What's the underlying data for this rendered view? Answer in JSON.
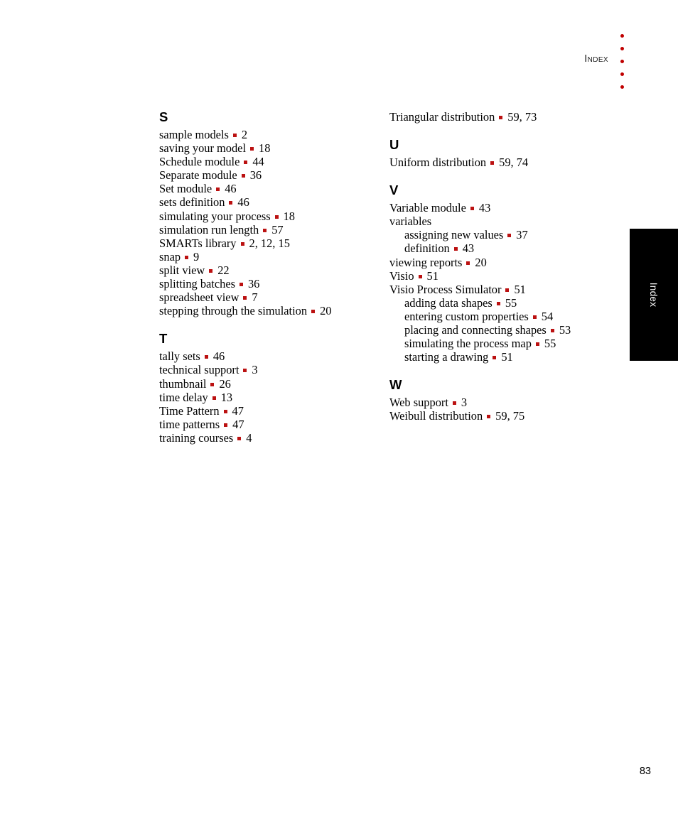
{
  "header": {
    "label": "Index",
    "dot_count": 5,
    "dot_color": "#c00000"
  },
  "side_tab": {
    "label": "Index",
    "background": "#000000",
    "text_color": "#ffffff"
  },
  "bullet_color": "#bb1111",
  "folio": {
    "page_number": "83"
  },
  "columns": [
    {
      "name": "left",
      "sections": [
        {
          "letter": "S",
          "entries": [
            {
              "text": "sample models",
              "pages": "2",
              "level": 0
            },
            {
              "text": "saving your model",
              "pages": "18",
              "level": 0
            },
            {
              "text": "Schedule module",
              "pages": "44",
              "level": 0
            },
            {
              "text": "Separate module",
              "pages": "36",
              "level": 0
            },
            {
              "text": "Set module",
              "pages": "46",
              "level": 0
            },
            {
              "text": "sets definition",
              "pages": "46",
              "level": 0
            },
            {
              "text": "simulating your process",
              "pages": "18",
              "level": 0
            },
            {
              "text": "simulation run length",
              "pages": "57",
              "level": 0
            },
            {
              "text": "SMARTs library",
              "pages": "2, 12, 15",
              "level": 0
            },
            {
              "text": "snap",
              "pages": "9",
              "level": 0
            },
            {
              "text": "split view",
              "pages": "22",
              "level": 0
            },
            {
              "text": "splitting batches",
              "pages": "36",
              "level": 0
            },
            {
              "text": "spreadsheet view",
              "pages": "7",
              "level": 0
            },
            {
              "text": "stepping through the simulation",
              "pages": "20",
              "level": 0
            }
          ]
        },
        {
          "letter": "T",
          "entries": [
            {
              "text": "tally sets",
              "pages": "46",
              "level": 0
            },
            {
              "text": "technical support",
              "pages": "3",
              "level": 0
            },
            {
              "text": "thumbnail",
              "pages": "26",
              "level": 0
            },
            {
              "text": "time delay",
              "pages": "13",
              "level": 0
            },
            {
              "text": "Time Pattern",
              "pages": "47",
              "level": 0
            },
            {
              "text": "time patterns",
              "pages": "47",
              "level": 0
            },
            {
              "text": "training courses",
              "pages": "4",
              "level": 0
            }
          ]
        }
      ]
    },
    {
      "name": "right",
      "sections": [
        {
          "letter": "",
          "entries": [
            {
              "text": "Triangular distribution",
              "pages": "59, 73",
              "level": 0
            }
          ]
        },
        {
          "letter": "U",
          "entries": [
            {
              "text": "Uniform distribution",
              "pages": "59, 74",
              "level": 0
            }
          ]
        },
        {
          "letter": "V",
          "entries": [
            {
              "text": "Variable module",
              "pages": "43",
              "level": 0
            },
            {
              "text": "variables",
              "pages": "",
              "level": 0
            },
            {
              "text": "assigning new values",
              "pages": "37",
              "level": 1
            },
            {
              "text": "definition",
              "pages": "43",
              "level": 1
            },
            {
              "text": "viewing reports",
              "pages": "20",
              "level": 0
            },
            {
              "text": "Visio",
              "pages": "51",
              "level": 0
            },
            {
              "text": "Visio Process Simulator",
              "pages": "51",
              "level": 0
            },
            {
              "text": "adding data shapes",
              "pages": "55",
              "level": 1
            },
            {
              "text": "entering custom properties",
              "pages": "54",
              "level": 1
            },
            {
              "text": "placing and connecting shapes",
              "pages": "53",
              "level": 1
            },
            {
              "text": "simulating the process map",
              "pages": "55",
              "level": 1
            },
            {
              "text": "starting a drawing",
              "pages": "51",
              "level": 1
            }
          ]
        },
        {
          "letter": "W",
          "entries": [
            {
              "text": "Web support",
              "pages": "3",
              "level": 0
            },
            {
              "text": "Weibull distribution",
              "pages": "59, 75",
              "level": 0
            }
          ]
        }
      ]
    }
  ]
}
